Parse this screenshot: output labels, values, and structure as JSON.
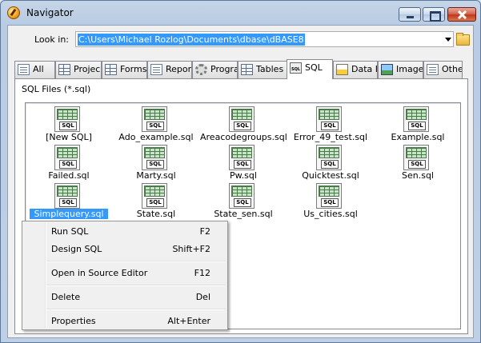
{
  "window": {
    "title": "Navigator"
  },
  "lookin": {
    "label": "Look in:",
    "value": "C:\\Users\\Michael Rozlog\\Documents\\dbase\\dBASE8"
  },
  "tabs": [
    {
      "label": "All",
      "icon": "all-icon"
    },
    {
      "label": "Projec",
      "icon": "project-icon"
    },
    {
      "label": "Forms",
      "icon": "forms-icon"
    },
    {
      "label": "Report",
      "icon": "reports-icon"
    },
    {
      "label": "Progra",
      "icon": "programs-icon"
    },
    {
      "label": "Tables",
      "icon": "tables-icon"
    },
    {
      "label": "SQL",
      "icon": "sql-icon",
      "active": true
    },
    {
      "label": "Data M",
      "icon": "datamodule-icon"
    },
    {
      "label": "Images",
      "icon": "images-icon"
    },
    {
      "label": "Other",
      "icon": "other-icon"
    }
  ],
  "panel": {
    "label": "SQL Files (*.sql)"
  },
  "files": [
    "[New SQL]",
    "Ado_example.sql",
    "Areacodegroups.sql",
    "Error_49_test.sql",
    "Example.sql",
    "Failed.sql",
    "Marty.sql",
    "Pw.sql",
    "Quicktest.sql",
    "Sen.sql",
    "Simplequery.sql",
    "State.sql",
    "State_sen.sql",
    "Us_cities.sql"
  ],
  "file_icon_tag": "SQL",
  "selected_file": "Simplequery.sql",
  "context_menu": {
    "items": [
      {
        "label": "Run SQL",
        "shortcut": "F2"
      },
      {
        "label": "Design SQL",
        "shortcut": "Shift+F2"
      },
      {
        "label": "Open in Source Editor",
        "shortcut": "F12"
      },
      {
        "label": "Delete",
        "shortcut": "Del"
      },
      {
        "label": "Properties",
        "shortcut": "Alt+Enter"
      }
    ]
  },
  "colors": {
    "selection": "#3399ff",
    "title_bar": "#c5d5e8",
    "close_button": "#c0381c"
  }
}
